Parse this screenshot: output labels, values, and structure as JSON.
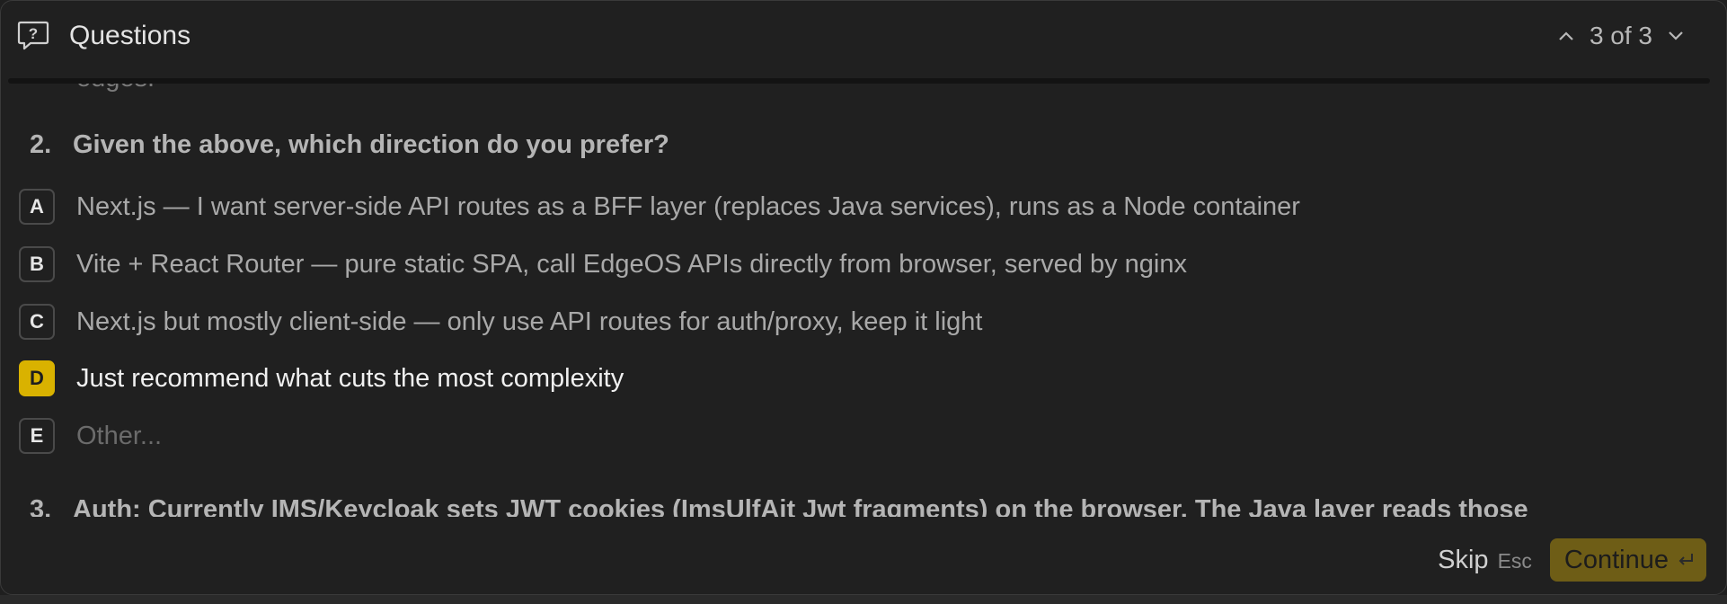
{
  "header": {
    "title": "Questions",
    "counter": "3 of 3"
  },
  "content": {
    "clipped_top_text": "edges.",
    "question2": {
      "number": "2.",
      "text": "Given the above, which direction do you prefer?"
    },
    "options": [
      {
        "key": "A",
        "label": "Next.js — I want server-side API routes as a BFF layer (replaces Java services), runs as a Node container"
      },
      {
        "key": "B",
        "label": "Vite + React Router — pure static SPA, call EdgeOS APIs directly from browser, served by nginx"
      },
      {
        "key": "C",
        "label": "Next.js but mostly client-side — only use API routes for auth/proxy, keep it light"
      },
      {
        "key": "D",
        "label": "Just recommend what cuts the most complexity",
        "selected": true
      },
      {
        "key": "E",
        "label": "Other..."
      }
    ],
    "question3": {
      "number": "3.",
      "text": "Auth: Currently IMS/Keycloak sets JWT cookies (ImsUlfAit Jwt fragments) on the browser. The Java layer reads those"
    }
  },
  "footer": {
    "skip_label": "Skip",
    "skip_hint": "Esc",
    "continue_label": "Continue"
  },
  "colors": {
    "accent": "#d9b200",
    "continue_bg": "#6e5d16",
    "panel_bg": "#202020"
  }
}
